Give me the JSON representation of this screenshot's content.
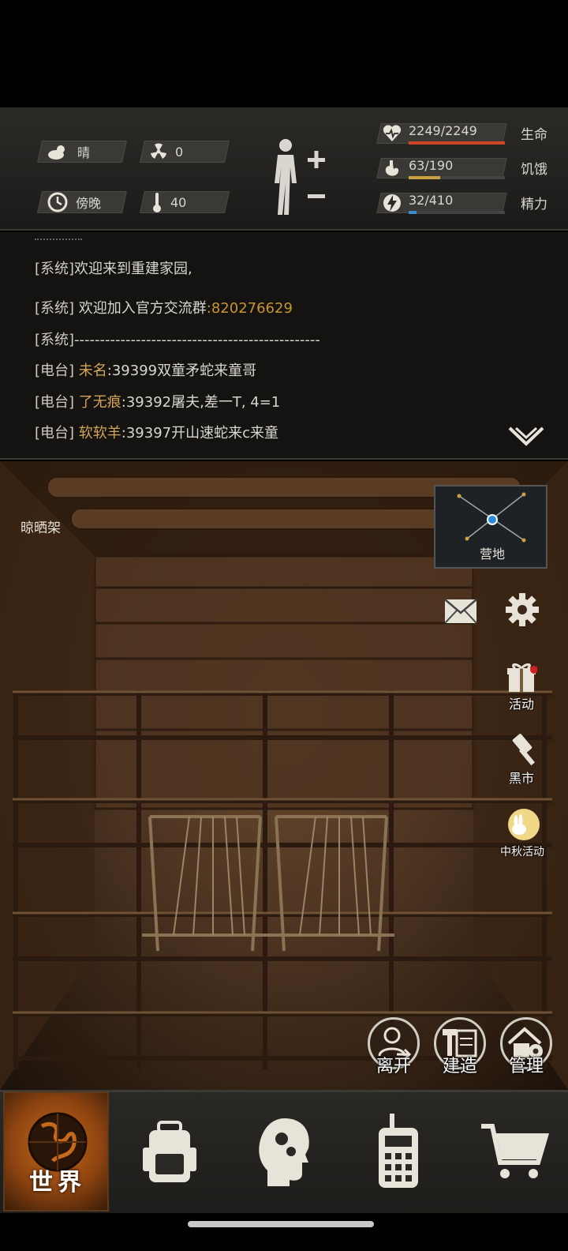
{
  "status": {
    "weather": "晴",
    "radiation": "0",
    "time_of_day": "傍晚",
    "temperature": "40"
  },
  "vitals": {
    "health": {
      "value": "2249/2249",
      "label": "生命",
      "fraction": 1.0,
      "color": "#d0442a"
    },
    "hunger": {
      "value": "63/190",
      "label": "饥饿",
      "fraction": 0.33,
      "color": "#c8a040"
    },
    "energy": {
      "value": "32/410",
      "label": "精力",
      "fraction": 0.08,
      "color": "#3c8ad0"
    }
  },
  "chat": {
    "lines": [
      {
        "tag": "[系统]",
        "text": "欢迎来到重建家园,"
      },
      {
        "tag": "[系统]",
        "text": " 欢迎加入官方交流群",
        "num": ":820276629"
      },
      {
        "tag": "[系统]",
        "text": "------------------------------------------------"
      },
      {
        "tag": "[电台]",
        "name": "未名",
        "text": ":39399双童矛蛇来童哥"
      },
      {
        "tag": "[电台]",
        "name": "了无痕",
        "text": ":39392屠夫,差一T, 4=1"
      },
      {
        "tag": "[电台]",
        "name": "软软羊",
        "text": ":39397开山速蛇来c来童"
      }
    ]
  },
  "scene": {
    "title": "晾晒架",
    "minimap_label": "营地"
  },
  "side_buttons": {
    "activity": "活动",
    "black_market": "黑市",
    "mid_autumn": "中秋活动"
  },
  "actions": {
    "leave": "离开",
    "build": "建造",
    "manage": "管理"
  },
  "nav": {
    "world": "世界",
    "items": [
      "backpack-icon",
      "skills-icon",
      "radio-icon",
      "shop-cart-icon"
    ]
  },
  "colors": {
    "accent_orange": "#c56a1c",
    "chat_name": "#d2a556",
    "chat_number": "#c9962d"
  }
}
